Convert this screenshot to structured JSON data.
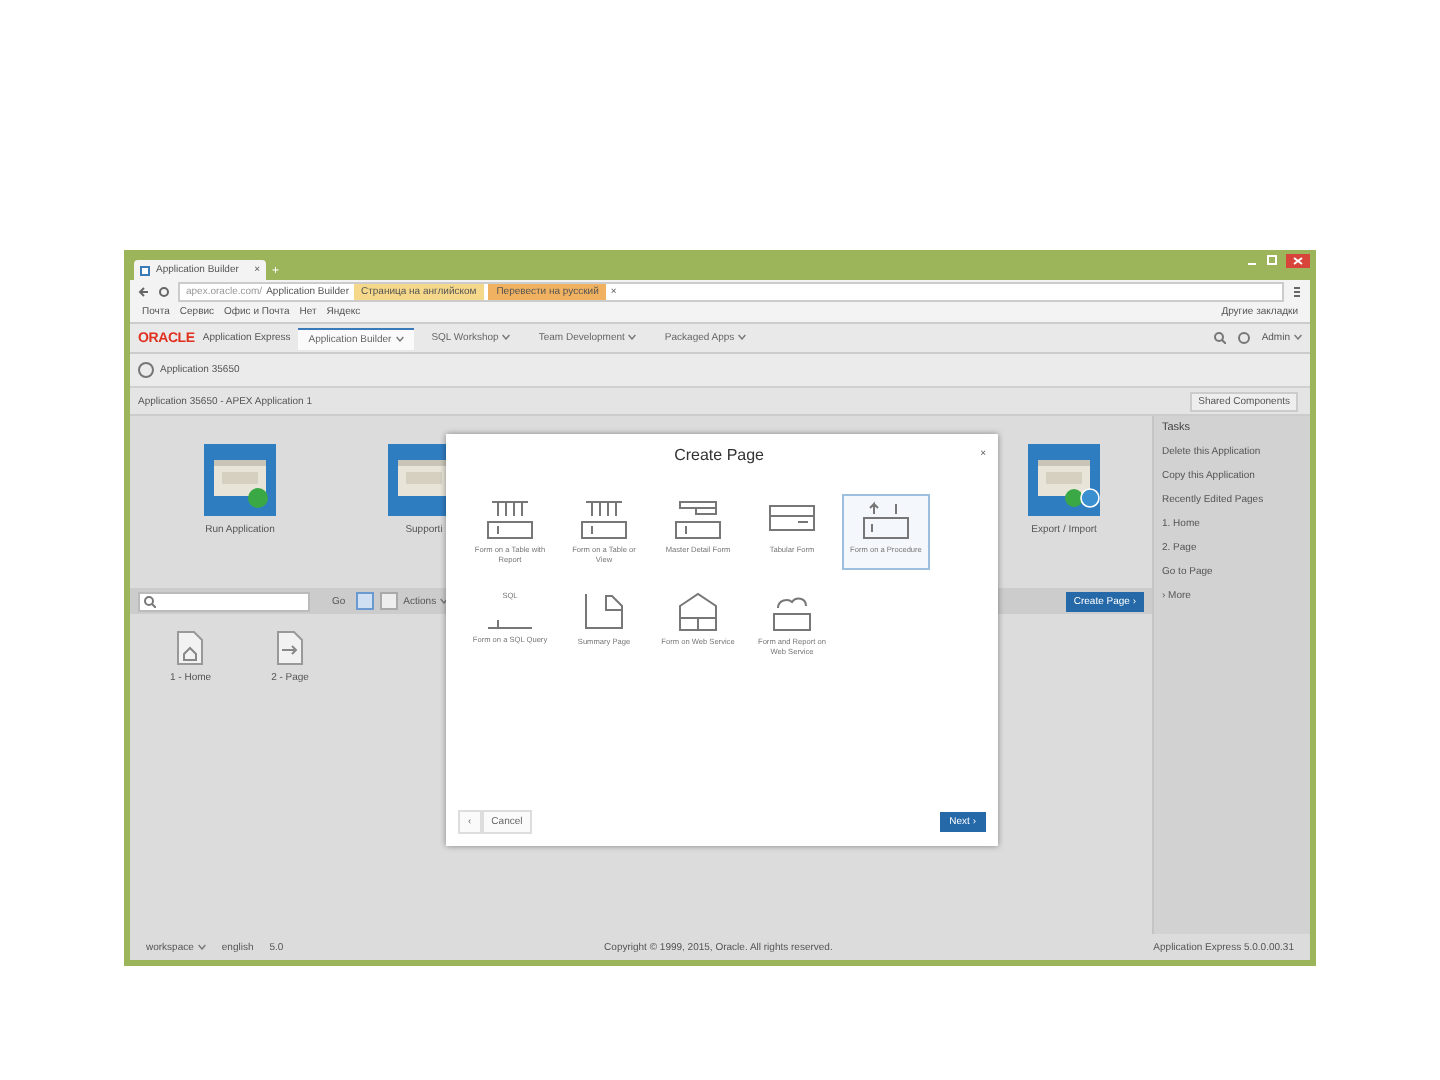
{
  "browser": {
    "tab": {
      "title": "Application Builder",
      "close": "×"
    },
    "new_tab": "+",
    "address": {
      "host": "apex.oracle.com/",
      "path": "Application Builder"
    },
    "bookmarks": [
      "Почта",
      "Сервис",
      "Офис и Почта",
      "Нет",
      "Яндекс"
    ],
    "other_bookmarks": "Другие закладки",
    "translate": [
      "Страница на английском",
      "Перевести на русский"
    ],
    "translate_close": "×"
  },
  "apex": {
    "logo": "ORACLE",
    "product": "Application Express",
    "menus": [
      {
        "label": "Application Builder",
        "selected": true
      },
      {
        "label": "SQL Workshop",
        "selected": false
      },
      {
        "label": "Team Development",
        "selected": false
      },
      {
        "label": "Packaged Apps",
        "selected": false
      }
    ],
    "user": "Admin"
  },
  "app_bar": {
    "title": "Application 35650"
  },
  "breadcrumb": "Application 35650 - APEX Application 1",
  "shared_components": "Shared Components",
  "tiles": [
    {
      "label": "Run Application",
      "kind": "run"
    },
    {
      "label": "Supporti",
      "kind": "support"
    },
    {
      "label": "Export / Import",
      "kind": "export"
    }
  ],
  "toolbar": {
    "go": "Go",
    "views": [
      {
        "selected": true
      },
      {
        "selected": false
      }
    ],
    "actions": "Actions",
    "create_page": "Create Page ›"
  },
  "pages": [
    {
      "label": "1 - Home",
      "kind": "home"
    },
    {
      "label": "2 - Page",
      "kind": "page"
    }
  ],
  "tasks": {
    "title": "Tasks",
    "items": [
      "Delete this Application",
      "Copy this Application",
      "Recently Edited Pages",
      "1. Home",
      "2. Page",
      "Go to Page",
      "› More"
    ]
  },
  "dialog": {
    "title": "Create Page",
    "close": "×",
    "options": [
      {
        "label": "Form on a Table with Report",
        "kind": "table-report",
        "selected": false
      },
      {
        "label": "Form on a Table or View",
        "kind": "table",
        "selected": false
      },
      {
        "label": "Master Detail Form",
        "kind": "master",
        "selected": false
      },
      {
        "label": "Tabular Form",
        "kind": "tabular",
        "selected": false
      },
      {
        "label": "Form on a Procedure",
        "kind": "procedure",
        "selected": true
      },
      {
        "label": "Form on a SQL Query",
        "kind": "sql",
        "icon_text": "SQL",
        "selected": false
      },
      {
        "label": "Summary Page",
        "kind": "summary",
        "selected": false
      },
      {
        "label": "Form on Web Service",
        "kind": "web",
        "selected": false
      },
      {
        "label": "Form and Report on Web Service",
        "kind": "web-report",
        "selected": false
      }
    ],
    "back": "‹",
    "cancel": "Cancel",
    "next": "Next ›"
  },
  "footer": {
    "workspace": "workspace",
    "language": "english",
    "version_short": "5.0",
    "copyright": "Copyright © 1999, 2015, Oracle. All rights reserved.",
    "version": "Application Express 5.0.0.00.31"
  }
}
